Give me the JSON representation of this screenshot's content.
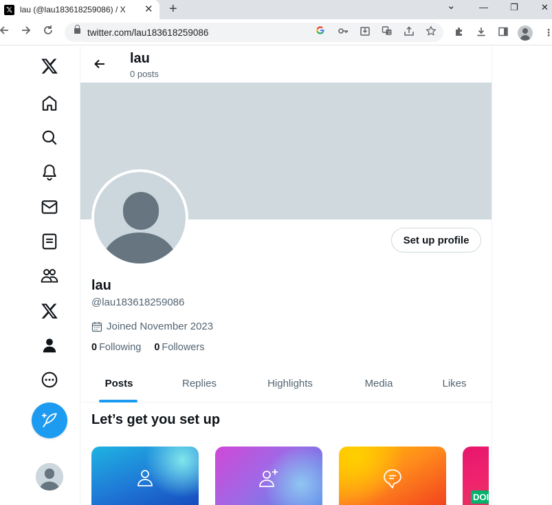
{
  "browser": {
    "tab_title": "lau (@lau183618259086) / X",
    "tab_close": "✕",
    "new_tab": "+",
    "url": "twitter.com/lau183618259086",
    "win_minimize": "—",
    "win_restore": "❐",
    "win_close": "✕",
    "win_dropdown": "⌄"
  },
  "nav": {
    "items": [
      {
        "name": "x-logo",
        "icon": "x-logo-icon"
      },
      {
        "name": "home",
        "icon": "home-icon"
      },
      {
        "name": "explore",
        "icon": "search-icon"
      },
      {
        "name": "notifications",
        "icon": "bell-icon"
      },
      {
        "name": "messages",
        "icon": "envelope-icon"
      },
      {
        "name": "lists",
        "icon": "list-icon"
      },
      {
        "name": "communities",
        "icon": "people-icon"
      },
      {
        "name": "premium",
        "icon": "x-logo-icon"
      },
      {
        "name": "profile",
        "icon": "person-icon"
      },
      {
        "name": "more",
        "icon": "more-circle-icon"
      }
    ],
    "post_button_icon": "feather-plus-icon"
  },
  "header": {
    "name": "lau",
    "post_count": "0 posts"
  },
  "profile": {
    "display_name": "lau",
    "handle": "@lau183618259086",
    "joined": "Joined November 2023",
    "following_count": "0",
    "following_label": "Following",
    "followers_count": "0",
    "followers_label": "Followers",
    "setup_button": "Set up profile",
    "banner_color": "#cfd9de"
  },
  "tabs": [
    {
      "label": "Posts",
      "active": true
    },
    {
      "label": "Replies",
      "active": false
    },
    {
      "label": "Highlights",
      "active": false
    },
    {
      "label": "Media",
      "active": false
    },
    {
      "label": "Likes",
      "active": false
    }
  ],
  "setup": {
    "title": "Let’s get you set up",
    "card4_badge": "DOI"
  },
  "colors": {
    "accent": "#1d9bf0",
    "text_primary": "#0f1419",
    "text_secondary": "#536471"
  }
}
